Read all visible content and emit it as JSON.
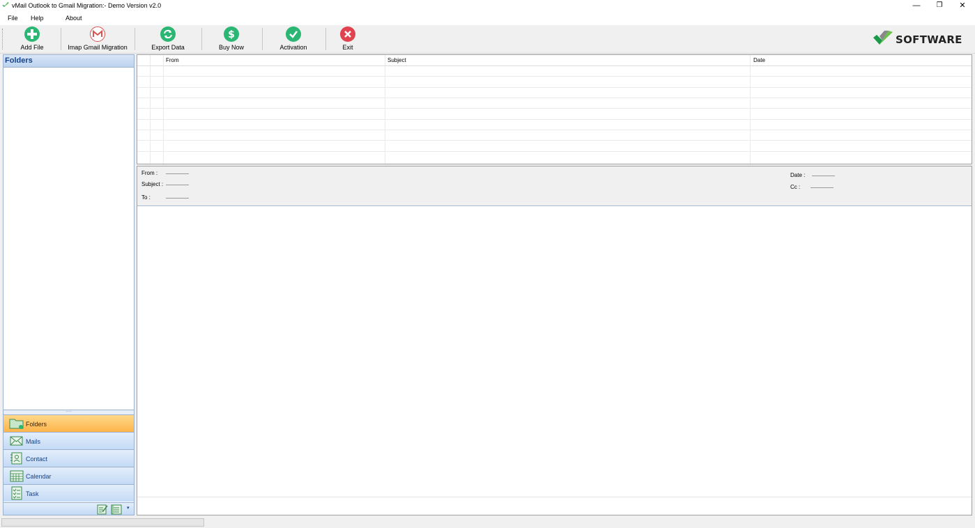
{
  "window": {
    "title": "vMail Outlook to Gmail Migration:- Demo Version v2.0",
    "controls": {
      "minimize": "—",
      "restore": "❐",
      "close": "✕"
    }
  },
  "menu": [
    "File",
    "Help",
    "About"
  ],
  "toolbar": {
    "buttons": [
      {
        "label": "Add File",
        "icon": "add-file-icon",
        "color": "#2bb673"
      },
      {
        "label": "Imap Gmail Migration",
        "icon": "gmail-icon",
        "color": "#d9534f"
      },
      {
        "label": "Export Data",
        "icon": "refresh-icon",
        "color": "#2bb673"
      },
      {
        "label": "Buy Now",
        "icon": "dollar-icon",
        "color": "#2bb673"
      },
      {
        "label": "Activation",
        "icon": "checkmark-icon",
        "color": "#2bb673"
      },
      {
        "label": "Exit",
        "icon": "close-circle-icon",
        "color": "#e0424f"
      }
    ],
    "logo_text": "SOFTWARE"
  },
  "sidebar": {
    "header": "Folders",
    "nav": [
      {
        "label": "Folders",
        "icon": "folder-icon",
        "active": true
      },
      {
        "label": "Mails",
        "icon": "mail-icon",
        "active": false
      },
      {
        "label": "Contact",
        "icon": "contact-icon",
        "active": false
      },
      {
        "label": "Calendar",
        "icon": "calendar-icon",
        "active": false
      },
      {
        "label": "Task",
        "icon": "task-icon",
        "active": false
      }
    ]
  },
  "mail_list": {
    "columns": [
      "From",
      "Subject",
      "Date"
    ]
  },
  "preview": {
    "from_label": "From :",
    "subject_label": "Subject :",
    "to_label": "To :",
    "date_label": "Date :",
    "cc_label": "Cc :"
  },
  "colors": {
    "accent_green": "#2bb673",
    "exit_red": "#e0424f",
    "panel_blue": "#c4daf5",
    "active_orange": "#fdb44b",
    "header_text": "#15428b"
  }
}
